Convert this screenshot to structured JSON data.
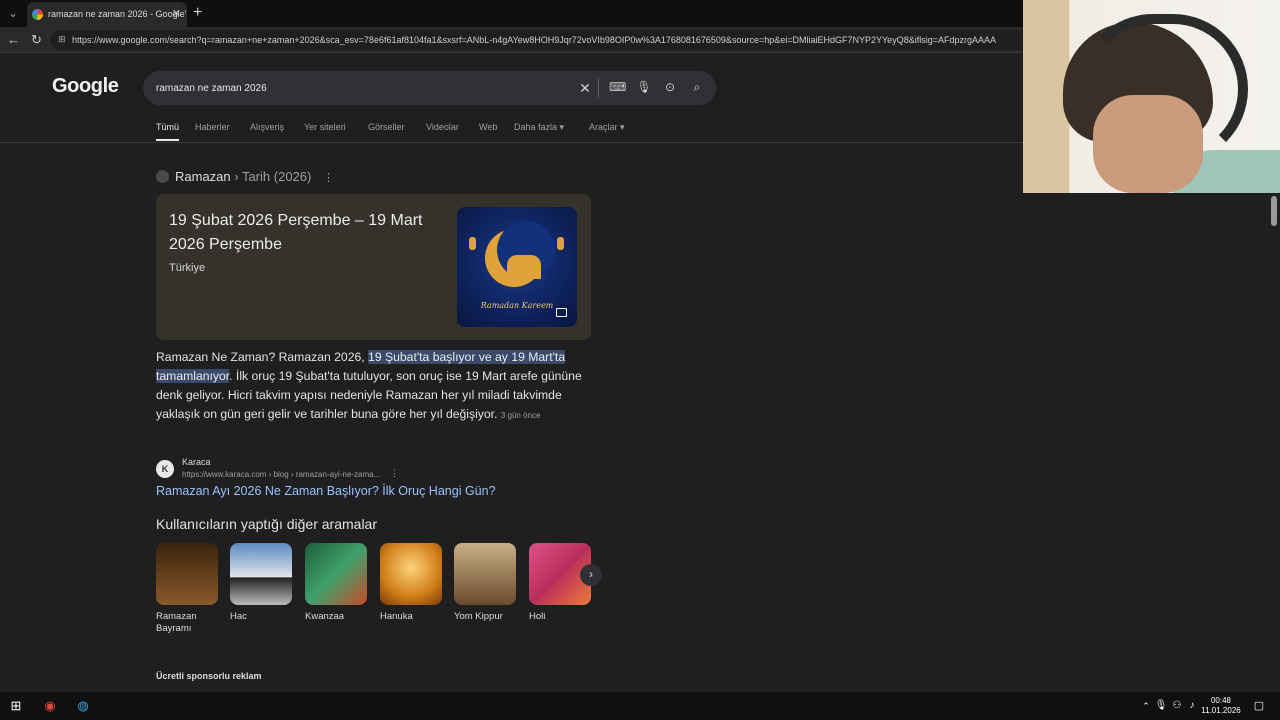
{
  "browser": {
    "tab_title": "ramazan ne zaman 2026 - Google'",
    "url": "https://www.google.com/search?q=ramazan+ne+zaman+2026&sca_esv=78e6f61af8104fa1&sxsrf=ANbL-n4gAYew8HOH9Jqr72voVIb98OIP0w%3A1768081676509&source=hp&ei=DMliaiEHdGF7NYP2YYeyQ8&iflsig=AFdpzrgAAAA"
  },
  "google": {
    "logo": "Google",
    "query": "ramazan ne zaman 2026",
    "tabs": [
      "Tümü",
      "Haberler",
      "Alışveriş",
      "Yer siteleri",
      "Görseller",
      "Videolar",
      "Web",
      "Daha fazla ▾",
      "Araçlar ▾"
    ]
  },
  "result": {
    "crumb_main": "Ramazan",
    "crumb_sub": "› Tarih (2026)",
    "date_text": "19 Şubat 2026 Perşembe – 19 Mart 2026 Perşembe",
    "country": "Türkiye",
    "image_caption": "Ramadan Kareem",
    "snippet_pre": "Ramazan Ne Zaman? Ramazan 2026, ",
    "snippet_hl": "19 Şubat'ta başlıyor ve ay 19 Mart'ta tamamlanıyor",
    "snippet_post": ". İlk oruç 19 Şubat'ta tutuluyor, son oruç ise 19 Mart arefe gününe denk geliyor. Hicri takvim yapısı nedeniyle Ramazan her yıl miladi takvimde yaklaşık on gün geri gelir ve tarihler buna göre her yıl değişiyor.",
    "snippet_ago": "3 gün önce",
    "source_name": "Karaca",
    "source_url": "https://www.karaca.com › blog › ramazan-ayi-ne-zama...",
    "link": "Ramazan Ayı 2026 Ne Zaman Başlıyor? İlk Oruç Hangi Gün?"
  },
  "related": {
    "heading": "Kullanıcıların yaptığı diğer aramalar",
    "items": [
      {
        "label": "Ramazan Bayramı",
        "color": "#5a3a1a"
      },
      {
        "label": "Hac",
        "color": "#b9c7d6"
      },
      {
        "label": "Kwanzaa",
        "color": "#2d7a4a"
      },
      {
        "label": "Hanuka",
        "color": "#c8801e"
      },
      {
        "label": "Yom Kippur",
        "color": "#7a5a3a"
      },
      {
        "label": "Holi",
        "color": "#b8457a"
      }
    ]
  },
  "sponsored": "Ücretli sponsorlu reklam",
  "taskbar": {
    "time": "00:48",
    "date": "11.01.2026"
  }
}
